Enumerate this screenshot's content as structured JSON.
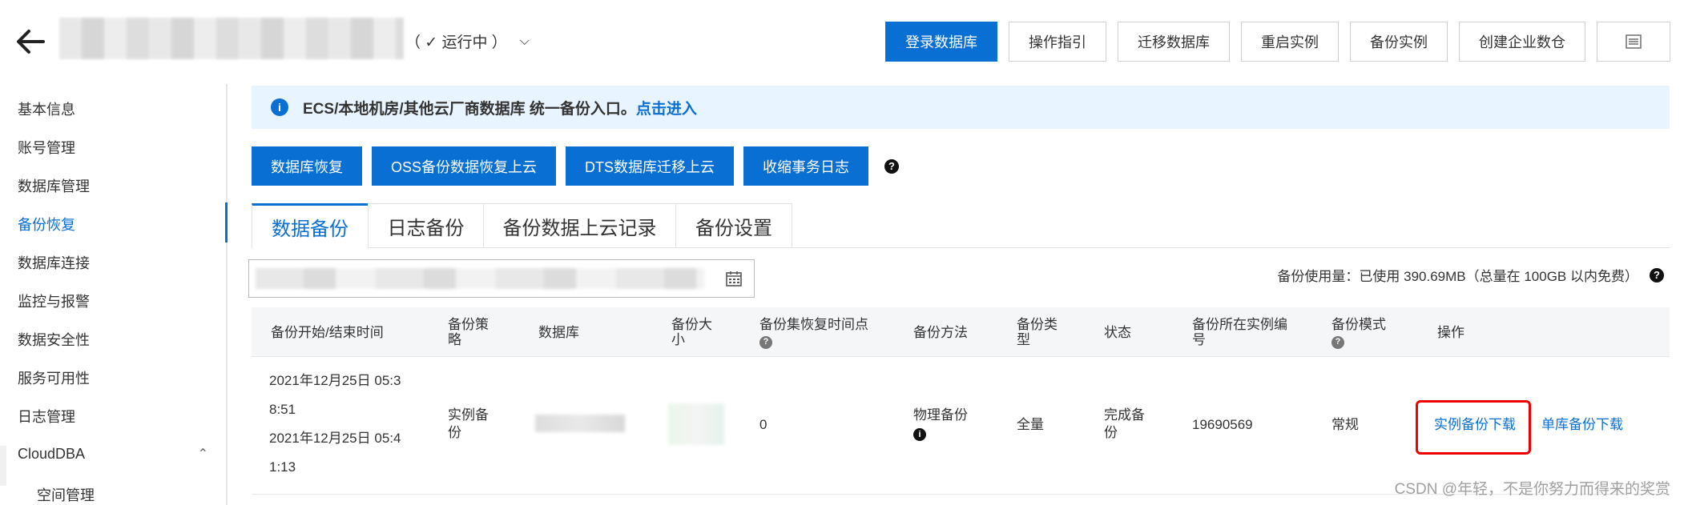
{
  "header": {
    "status_text": "（ ✓ 运行中 ）",
    "buttons": [
      "登录数据库",
      "操作指引",
      "迁移数据库",
      "重启实例",
      "备份实例",
      "创建企业数仓"
    ]
  },
  "sidebar": {
    "items": [
      "基本信息",
      "账号管理",
      "数据库管理",
      "备份恢复",
      "数据库连接",
      "监控与报警",
      "数据安全性",
      "服务可用性",
      "日志管理",
      "CloudDBA",
      "空间管理"
    ],
    "active_index": 3
  },
  "notice": {
    "text": "ECS/本地机房/其他云厂商数据库 统一备份入口。",
    "link": "点击进入"
  },
  "actions": [
    "数据库恢复",
    "OSS备份数据恢复上云",
    "DTS数据库迁移上云",
    "收缩事务日志"
  ],
  "tabs": [
    "数据备份",
    "日志备份",
    "备份数据上云记录",
    "备份设置"
  ],
  "usage_text": "备份使用量：已使用 390.69MB（总量在 100GB 以内免费）",
  "table": {
    "headers": {
      "time": "备份开始/结束时间",
      "policy": "备份策略",
      "database": "数据库",
      "size": "备份大小",
      "restore_point": "备份集恢复时间点",
      "method": "备份方法",
      "type": "备份类型",
      "status": "状态",
      "instance": "备份所在实例编号",
      "mode": "备份模式",
      "ops": "操作"
    },
    "row": {
      "start": "2021年12月25日 05:38:51",
      "start_l1": "2021年12月25日 05:3",
      "start_l2": "8:51",
      "end_l1": "2021年12月25日 05:4",
      "end_l2": "1:13",
      "policy": "实例备份",
      "restore_point": "0",
      "method": "物理备份",
      "type": "全量",
      "status": "完成备份",
      "instance": "19690569",
      "mode": "常规",
      "op1": "实例备份下载",
      "op2": "单库备份下载"
    }
  },
  "watermark": "CSDN @年轻，不是你努力而得来的奖赏"
}
